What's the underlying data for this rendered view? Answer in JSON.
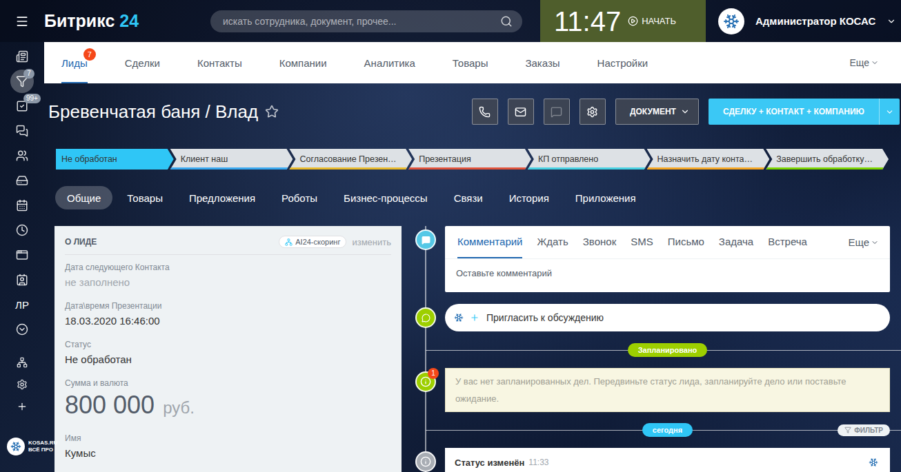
{
  "header": {
    "logo": {
      "name": "Битрикс",
      "number": "24"
    },
    "search": {
      "placeholder": "искать сотрудника, документ, прочее..."
    },
    "clock": {
      "time": "11:47",
      "action": "НАЧАТЬ"
    },
    "user": {
      "name": "Администратор КОСАС"
    }
  },
  "sidebar": {
    "items": [
      {
        "kind": "icon",
        "label": "",
        "badge": "",
        "selected": false
      },
      {
        "kind": "icon",
        "label": "",
        "badge": "7",
        "selected": true
      },
      {
        "kind": "icon",
        "label": "",
        "badge": "99+",
        "selected": false
      },
      {
        "kind": "icon",
        "label": "",
        "badge": "",
        "selected": false
      },
      {
        "kind": "icon",
        "label": "",
        "badge": "",
        "selected": false
      },
      {
        "kind": "icon",
        "label": "",
        "badge": "",
        "selected": false
      },
      {
        "kind": "icon",
        "label": "",
        "badge": "",
        "selected": false
      },
      {
        "kind": "icon",
        "label": "",
        "badge": "",
        "selected": false
      },
      {
        "kind": "icon",
        "label": "",
        "badge": "",
        "selected": false
      },
      {
        "kind": "icon",
        "label": "",
        "badge": "",
        "selected": false
      },
      {
        "kind": "text",
        "label": "ЛР",
        "badge": "",
        "selected": false
      },
      {
        "kind": "icon",
        "label": "",
        "badge": "",
        "selected": false
      }
    ],
    "tools": [
      {
        "selected": false
      },
      {
        "selected": false
      },
      {
        "selected": false
      }
    ],
    "footer": {
      "brand": "KOSAS.RU",
      "tagline": "ВСЁ ПРО"
    }
  },
  "nav": {
    "items": [
      {
        "label": "Лиды",
        "selected": true,
        "badge": "7"
      },
      {
        "label": "Сделки",
        "selected": false,
        "badge": ""
      },
      {
        "label": "Контакты",
        "selected": false,
        "badge": ""
      },
      {
        "label": "Компании",
        "selected": false,
        "badge": ""
      },
      {
        "label": "Аналитика",
        "selected": false,
        "badge": ""
      },
      {
        "label": "Товары",
        "selected": false,
        "badge": ""
      },
      {
        "label": "Заказы",
        "selected": false,
        "badge": ""
      },
      {
        "label": "Настройки",
        "selected": false,
        "badge": ""
      }
    ],
    "more": "Еще"
  },
  "title": {
    "text": "Бревенчатая баня / Влад",
    "starred": false
  },
  "toolbar": {
    "icon_buttons": [
      {
        "disabled": false
      },
      {
        "disabled": false
      },
      {
        "disabled": true
      },
      {
        "disabled": false
      }
    ],
    "document": "ДОКУМЕНТ",
    "primary": "СДЕЛКУ + КОНТАКТ + КОМПАНИЮ"
  },
  "stages": [
    {
      "label": "Не обработан",
      "selected": true,
      "color": "#2fc6f6"
    },
    {
      "label": "Клиент наш",
      "selected": false,
      "color": "#39a8ef"
    },
    {
      "label": "Согласование Презен…",
      "selected": false,
      "color": "#e8b92b"
    },
    {
      "label": "Презентация",
      "selected": false,
      "color": "#e0533b"
    },
    {
      "label": "КП отправлено",
      "selected": false,
      "color": "#47d1e2"
    },
    {
      "label": "Назначить дату конта…",
      "selected": false,
      "color": "#f5a623"
    },
    {
      "label": "Завершить обработку…",
      "selected": false,
      "color": "#7bd500"
    }
  ],
  "detail_tabs": [
    {
      "label": "Общие",
      "selected": true
    },
    {
      "label": "Товары",
      "selected": false
    },
    {
      "label": "Предложения",
      "selected": false
    },
    {
      "label": "Роботы",
      "selected": false
    },
    {
      "label": "Бизнес-процессы",
      "selected": false
    },
    {
      "label": "Связи",
      "selected": false
    },
    {
      "label": "История",
      "selected": false
    },
    {
      "label": "Приложения",
      "selected": false
    }
  ],
  "lead_panel": {
    "title": "О ЛИДЕ",
    "scoring": "AI24-скоринг",
    "edit": "изменить",
    "fields": [
      {
        "kind": "text",
        "label": "Дата следующего Контакта",
        "value": "не заполнено",
        "empty": true,
        "currency": ""
      },
      {
        "kind": "text",
        "label": "Дата\\время Презентации",
        "value": "18.03.2020 16:46:00",
        "empty": false,
        "currency": ""
      },
      {
        "kind": "text",
        "label": "Статус",
        "value": "Не обработан",
        "empty": false,
        "currency": ""
      },
      {
        "kind": "money",
        "label": "Сумма и валюта",
        "value": "800 000",
        "empty": false,
        "currency": "руб."
      },
      {
        "kind": "text",
        "label": "Имя",
        "value": "Кумыс",
        "empty": false,
        "currency": ""
      }
    ]
  },
  "timeline": {
    "composer": {
      "tabs": [
        {
          "label": "Комментарий",
          "selected": true
        },
        {
          "label": "Ждать",
          "selected": false
        },
        {
          "label": "Звонок",
          "selected": false
        },
        {
          "label": "SMS",
          "selected": false
        },
        {
          "label": "Письмо",
          "selected": false
        },
        {
          "label": "Задача",
          "selected": false
        },
        {
          "label": "Встреча",
          "selected": false
        }
      ],
      "more": "Еще",
      "placeholder": "Оставьте комментарий"
    },
    "invite": "Пригласить к обсуждению",
    "planned": {
      "label": "Запланировано",
      "message": "У вас нет запланированных дел. Передвиньте статус лида, запланируйте дело или поставьте ожидание.",
      "badge": "1"
    },
    "today": {
      "label": "сегодня",
      "filter": "ФИЛЬТР"
    },
    "entries": [
      {
        "title": "Статус изменён",
        "time": "11:33"
      }
    ]
  }
}
